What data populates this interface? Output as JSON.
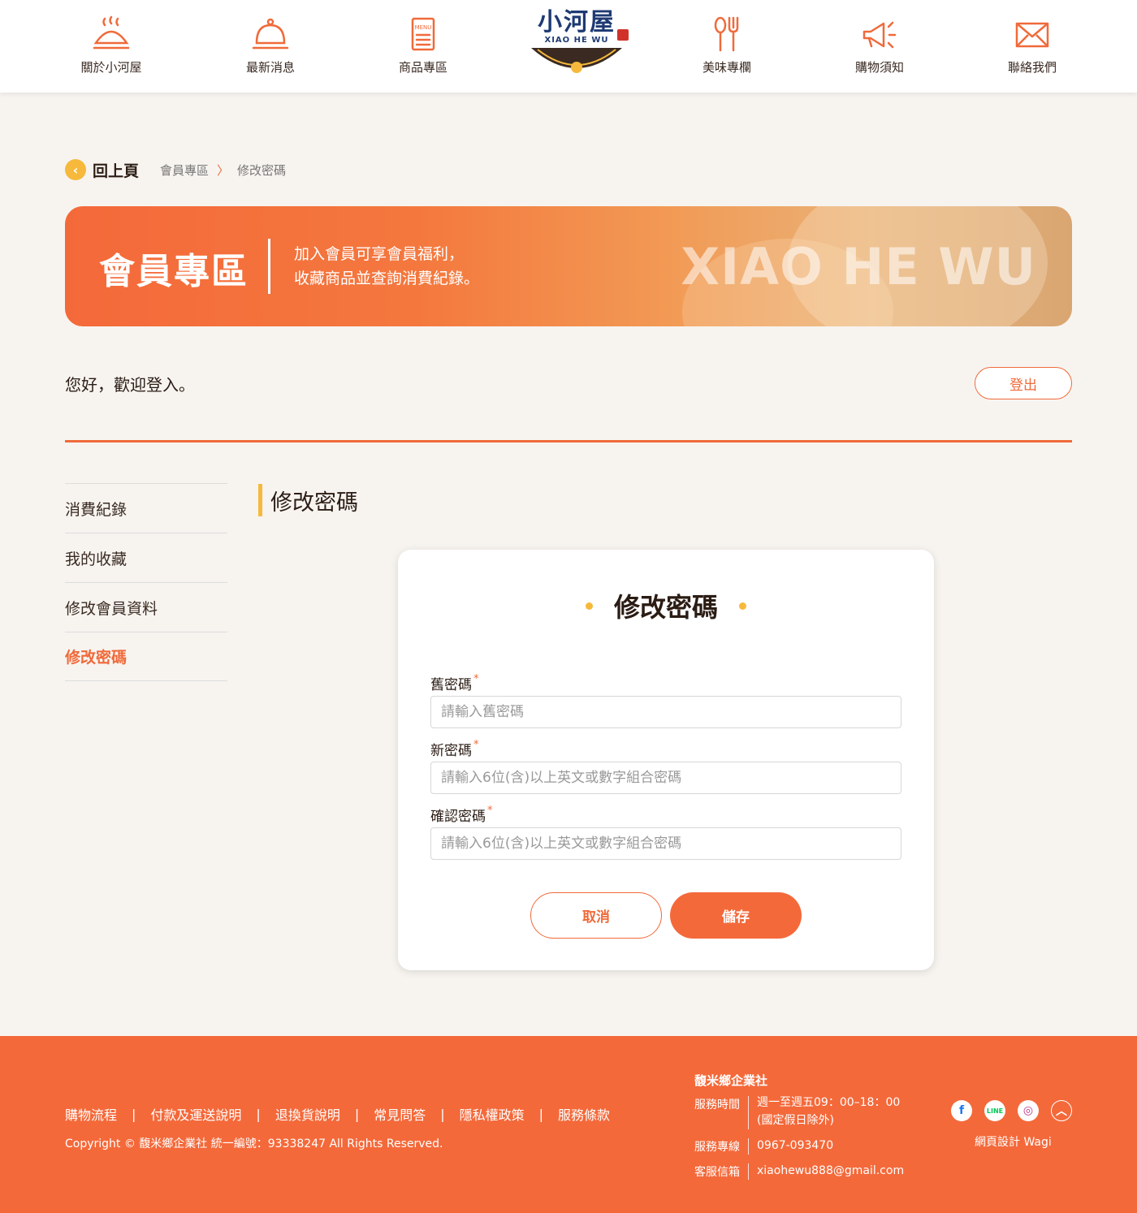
{
  "header": {
    "nav_left": [
      {
        "label": "關於小河屋",
        "icon": "dumpling-icon"
      },
      {
        "label": "最新消息",
        "icon": "cloche-icon"
      },
      {
        "label": "商品專區",
        "icon": "menu-icon"
      }
    ],
    "logo": {
      "brand": "小河屋",
      "brand_sub": "XIAO HE WU"
    },
    "nav_right": [
      {
        "label": "美味專欄",
        "icon": "fork-spoon-icon"
      },
      {
        "label": "購物須知",
        "icon": "megaphone-icon"
      },
      {
        "label": "聯絡我們",
        "icon": "mail-icon"
      }
    ]
  },
  "breadcrumb": {
    "back_label": "回上頁",
    "items": [
      "會員專區",
      "修改密碼"
    ]
  },
  "banner": {
    "title": "會員專區",
    "line1": "加入會員可享會員福利，",
    "line2": "收藏商品並查詢消費紀錄。",
    "watermark": "XIAO HE WU"
  },
  "welcome": {
    "text": "您好，歡迎登入。",
    "logout_label": "登出"
  },
  "side_menu": [
    {
      "label": "消費紀錄",
      "active": false
    },
    {
      "label": "我的收藏",
      "active": false
    },
    {
      "label": "修改會員資料",
      "active": false
    },
    {
      "label": "修改密碼",
      "active": true
    }
  ],
  "section_title": "修改密碼",
  "form": {
    "title": "修改密碼",
    "fields": [
      {
        "label": "舊密碼",
        "required_mark": "*",
        "value": "",
        "placeholder": "請輸入舊密碼"
      },
      {
        "label": "新密碼",
        "required_mark": "*",
        "value": "",
        "placeholder": "請輸入6位(含)以上英文或數字組合密碼"
      },
      {
        "label": "確認密碼",
        "required_mark": "*",
        "value": "",
        "placeholder": "請輸入6位(含)以上英文或數字組合密碼"
      }
    ],
    "cancel_label": "取消",
    "save_label": "儲存"
  },
  "footer": {
    "links": [
      "購物流程",
      "付款及運送說明",
      "退換貨說明",
      "常見問答",
      "隱私權政策",
      "服務條款"
    ],
    "link_separator": "|",
    "copyright": "Copyright © 馥米鄉企業社 統一編號：93338247 All Rights Reserved.",
    "company": "馥米鄉企業社",
    "hours_key": "服務時間",
    "hours_value1": "週一至週五09：00–18：00",
    "hours_value2": "(國定假日除外)",
    "phone_key": "服務專線",
    "phone_value": "0967-093470",
    "email_key": "客服信箱",
    "email_value": "xiaohewu888@gmail.com",
    "social": [
      {
        "icon": "facebook-icon",
        "glyph": "f"
      },
      {
        "icon": "line-icon",
        "glyph": "LINE"
      },
      {
        "icon": "instagram-icon",
        "glyph": "◎"
      },
      {
        "icon": "back-to-top-icon",
        "glyph": "︿"
      }
    ],
    "designer": "網頁設計 Wagi"
  },
  "colors": {
    "primary": "#f4693a",
    "accent": "#f6b93b",
    "brand_navy": "#1e3a73",
    "text_dark": "#2b1c14"
  }
}
